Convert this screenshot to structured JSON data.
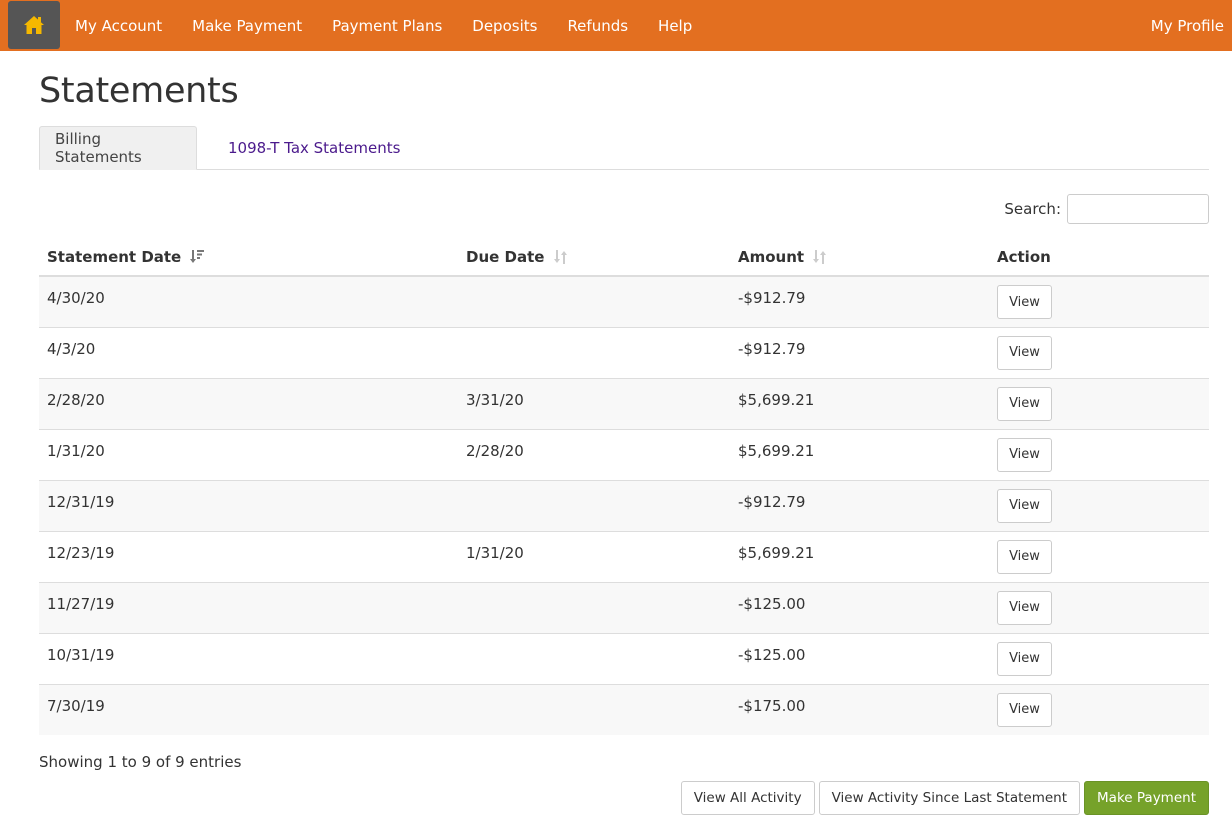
{
  "nav": {
    "home_icon": "home-icon",
    "items": [
      {
        "label": "My Account"
      },
      {
        "label": "Make Payment"
      },
      {
        "label": "Payment Plans"
      },
      {
        "label": "Deposits"
      },
      {
        "label": "Refunds"
      },
      {
        "label": "Help"
      }
    ],
    "profile_label": "My Profile"
  },
  "page": {
    "title": "Statements",
    "tabs": [
      {
        "label": "Billing Statements",
        "active": true
      },
      {
        "label": "1098-T Tax Statements",
        "active": false
      }
    ]
  },
  "search": {
    "label": "Search:",
    "value": "",
    "placeholder": ""
  },
  "table": {
    "columns": [
      {
        "label": "Statement Date",
        "sort": "descending"
      },
      {
        "label": "Due Date",
        "sort": "none"
      },
      {
        "label": "Amount",
        "sort": "none"
      },
      {
        "label": "Action"
      }
    ],
    "rows": [
      {
        "statement_date": "4/30/20",
        "due_date": "",
        "amount": "-$912.79",
        "action": "View"
      },
      {
        "statement_date": "4/3/20",
        "due_date": "",
        "amount": "-$912.79",
        "action": "View"
      },
      {
        "statement_date": "2/28/20",
        "due_date": "3/31/20",
        "amount": "$5,699.21",
        "action": "View"
      },
      {
        "statement_date": "1/31/20",
        "due_date": "2/28/20",
        "amount": "$5,699.21",
        "action": "View"
      },
      {
        "statement_date": "12/31/19",
        "due_date": "",
        "amount": "-$912.79",
        "action": "View"
      },
      {
        "statement_date": "12/23/19",
        "due_date": "1/31/20",
        "amount": "$5,699.21",
        "action": "View"
      },
      {
        "statement_date": "11/27/19",
        "due_date": "",
        "amount": "-$125.00",
        "action": "View"
      },
      {
        "statement_date": "10/31/19",
        "due_date": "",
        "amount": "-$125.00",
        "action": "View"
      },
      {
        "statement_date": "7/30/19",
        "due_date": "",
        "amount": "-$175.00",
        "action": "View"
      }
    ],
    "info": "Showing 1 to 9 of 9 entries"
  },
  "actions": {
    "view_all": "View All Activity",
    "view_since_last": "View Activity Since Last Statement",
    "make_payment": "Make Payment"
  },
  "colors": {
    "nav_bg": "#e36f20",
    "home_bg": "#555555",
    "home_icon": "#f5b800",
    "tab_link": "#4b1a8c",
    "primary_button": "#76a22a"
  }
}
